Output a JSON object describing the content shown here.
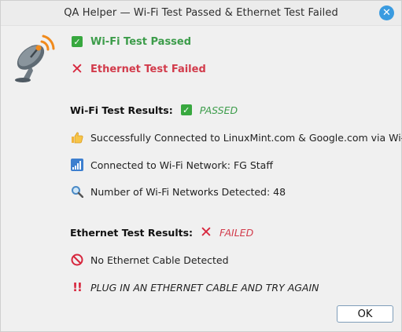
{
  "window": {
    "title": "QA Helper  —  Wi-Fi Test Passed & Ethernet Test Failed",
    "close_label": "✕",
    "app_icon": "satellite-dish-icon"
  },
  "summary": {
    "wifi": {
      "icon": "check-icon",
      "label": "Wi-Fi Test Passed"
    },
    "ethernet": {
      "icon": "x-icon",
      "label": "Ethernet Test Failed"
    }
  },
  "wifi_results": {
    "heading": "Wi-Fi Test Results:",
    "status": "PASSED",
    "items": [
      {
        "icon": "thumbs-up-icon",
        "text": "Successfully Connected to LinuxMint.com & Google.com via Wi-Fi"
      },
      {
        "icon": "signal-strength-icon",
        "text": "Connected to Wi-Fi Network: FG Staff"
      },
      {
        "icon": "magnifier-icon",
        "text": "Number of Wi-Fi Networks Detected: 48"
      }
    ]
  },
  "ethernet_results": {
    "heading": "Ethernet Test Results:",
    "status": "FAILED",
    "items": [
      {
        "icon": "no-entry-icon",
        "text": "No Ethernet Cable Detected"
      },
      {
        "icon": "double-exclamation-icon",
        "text": "PLUG IN AN ETHERNET CABLE AND TRY AGAIN"
      }
    ]
  },
  "buttons": {
    "ok_label": "OK"
  },
  "colors": {
    "pass": "#3c9c4a",
    "fail": "#d23b4b",
    "accent": "#3a9be0"
  }
}
